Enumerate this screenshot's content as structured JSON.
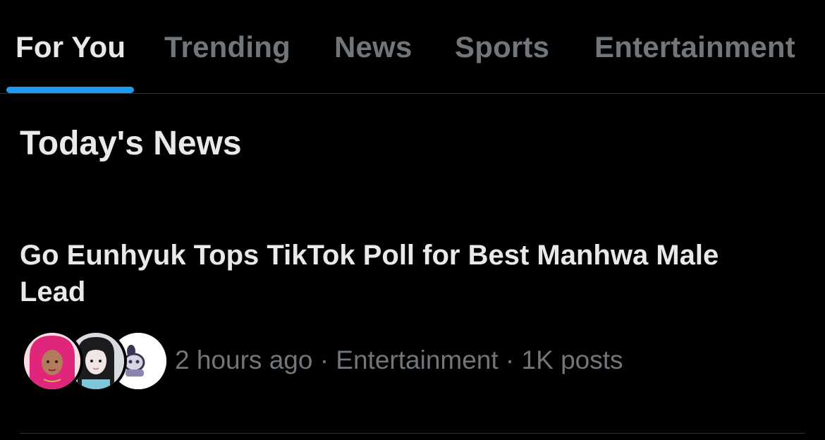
{
  "tabs": [
    {
      "label": "For You",
      "active": true
    },
    {
      "label": "Trending",
      "active": false
    },
    {
      "label": "News",
      "active": false
    },
    {
      "label": "Sports",
      "active": false
    },
    {
      "label": "Entertainment",
      "active": false
    }
  ],
  "colors": {
    "background": "#000000",
    "text_primary": "#e7e9ea",
    "text_secondary": "#71767b",
    "accent": "#1d9bf0",
    "divider": "#2f3336"
  },
  "section": {
    "title": "Today's News"
  },
  "news_item": {
    "headline": "Go Eunhyuk Tops TikTok Poll for Best Manhwa Male Lead",
    "meta": "2 hours ago · Entertainment · 1K posts",
    "avatars": [
      "avatar-pink-hair-user",
      "avatar-black-hair-user",
      "avatar-cartoon-user"
    ]
  }
}
